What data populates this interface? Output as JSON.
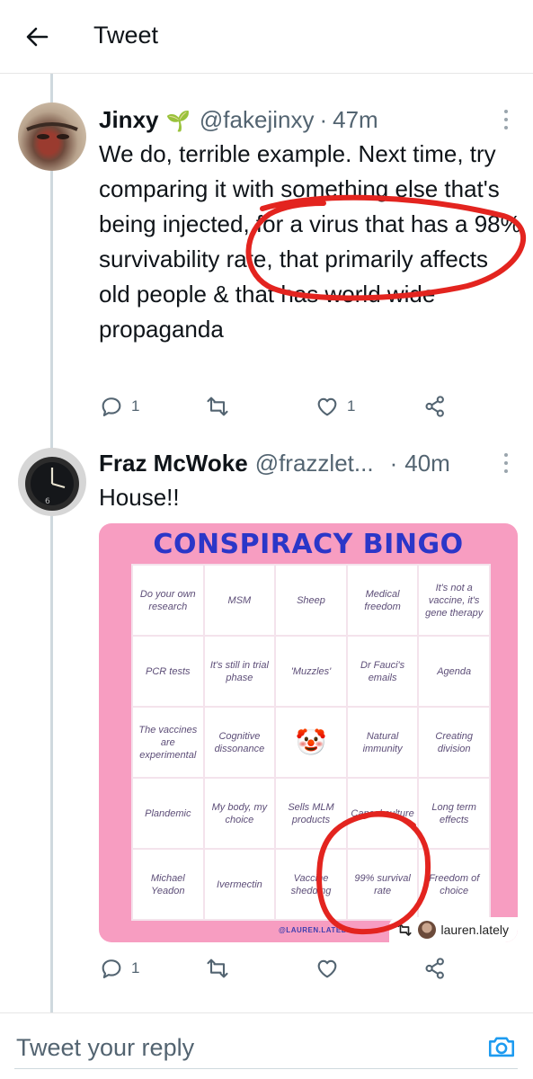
{
  "header": {
    "title": "Tweet"
  },
  "tweets": [
    {
      "name": "Jinxy",
      "emoji": "🌱",
      "handle": "@fakejinxy",
      "separator": "·",
      "time": "47m",
      "text": "We do, terrible example. Next time, try comparing it with something else that's being injected, for a virus that has a 98% survivability rate, that primarily affects old people & that has world wide propaganda",
      "reply_count": "1",
      "like_count": "1"
    },
    {
      "name": "Fraz McWoke",
      "handle": "@frazzlet...",
      "separator": "·",
      "time": "40m",
      "text": "House!!",
      "reply_count": "1",
      "image": {
        "title": "CONSPIRACY BINGO",
        "cells": [
          "Do your own research",
          "MSM",
          "Sheep",
          "Medical freedom",
          "It's not a vaccine, it's gene therapy",
          "PCR tests",
          "It's still in trial phase",
          "'Muzzles'",
          "Dr Fauci's emails",
          "Agenda",
          "The vaccines are experimental",
          "Cognitive dissonance",
          "🤡",
          "Natural immunity",
          "Creating division",
          "Plandemic",
          "My body, my choice",
          "Sells MLM products",
          "Cancel culture",
          "Long term effects",
          "Michael Yeadon",
          "Ivermectin",
          "Vaccine shedding",
          "99% survival rate",
          "Freedom of choice"
        ],
        "watermark": "@LAUREN.LATELY",
        "repost_user": "lauren.lately"
      }
    }
  ],
  "reply": {
    "placeholder": "Tweet your reply"
  },
  "colors": {
    "annotation_red": "#e3241f",
    "bingo_pink": "#f79dc1",
    "bingo_title": "#2b36c8",
    "muted": "#536471"
  },
  "icons": [
    "back-arrow-icon",
    "more-options-icon",
    "reply-icon",
    "retweet-icon",
    "like-icon",
    "share-icon",
    "camera-icon",
    "clown-emoji",
    "sprout-emoji"
  ]
}
